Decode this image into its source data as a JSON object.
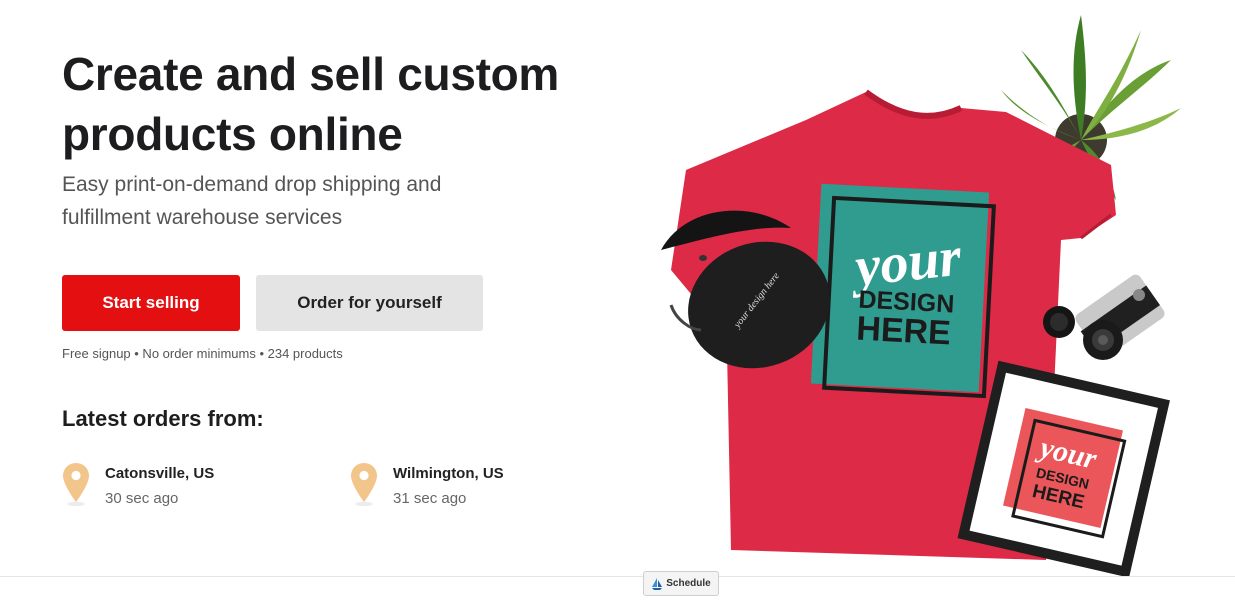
{
  "hero": {
    "title_line1": "Create and sell custom",
    "title_line2": "products online",
    "subtitle_line1": "Easy print-on-demand drop shipping and",
    "subtitle_line2": "fulfillment warehouse services",
    "primary_button": "Start selling",
    "secondary_button": "Order for yourself",
    "perks": "Free signup • No order minimums • 234 products"
  },
  "latest_orders": {
    "heading": "Latest orders from:",
    "items": [
      {
        "city": "Catonsville, US",
        "time": "30 sec ago"
      },
      {
        "city": "Wilmington, US",
        "time": "31 sec ago"
      }
    ]
  },
  "image": {
    "shirt_text_line1": "your",
    "shirt_text_line2": "DESIGN",
    "shirt_text_line3": "HERE",
    "cap_text": "your design here"
  },
  "widget": {
    "label": "Schedule",
    "icon": "sailboat-icon"
  },
  "colors": {
    "primary": "#e30f11",
    "secondary_bg": "#e4e4e4",
    "pin": "#f2c68b",
    "shirt": "#dd2a46",
    "design_teal": "#2f9c8f"
  }
}
